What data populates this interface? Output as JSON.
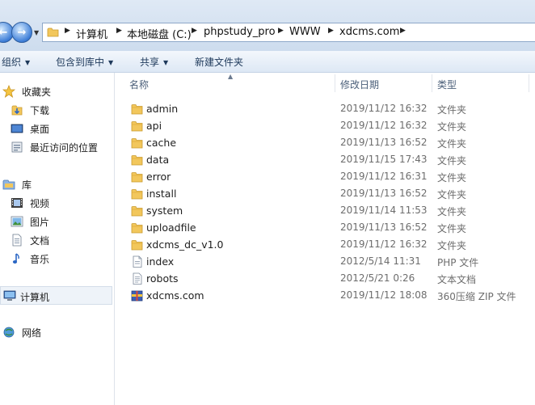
{
  "address": {
    "crumbs": [
      "计算机",
      "本地磁盘 (C:)",
      "phpstudy_pro",
      "WWW",
      "xdcms.com"
    ]
  },
  "toolbar": {
    "organize": "组织",
    "include_in_library": "包含到库中",
    "share": "共享",
    "new_folder": "新建文件夹"
  },
  "navpane": {
    "favorites": "收藏夹",
    "downloads": "下载",
    "desktop": "桌面",
    "recent": "最近访问的位置",
    "libraries": "库",
    "videos": "视频",
    "pictures": "图片",
    "documents": "文档",
    "music": "音乐",
    "computer": "计算机",
    "network": "网络"
  },
  "columns": {
    "name": "名称",
    "date_modified": "修改日期",
    "type": "类型"
  },
  "files": [
    {
      "name": "admin",
      "date": "2019/11/12 16:32",
      "type": "文件夹",
      "icon": "folder-icon"
    },
    {
      "name": "api",
      "date": "2019/11/12 16:32",
      "type": "文件夹",
      "icon": "folder-icon"
    },
    {
      "name": "cache",
      "date": "2019/11/13 16:52",
      "type": "文件夹",
      "icon": "folder-icon"
    },
    {
      "name": "data",
      "date": "2019/11/15 17:43",
      "type": "文件夹",
      "icon": "folder-icon"
    },
    {
      "name": "error",
      "date": "2019/11/12 16:31",
      "type": "文件夹",
      "icon": "folder-icon"
    },
    {
      "name": "install",
      "date": "2019/11/13 16:52",
      "type": "文件夹",
      "icon": "folder-icon"
    },
    {
      "name": "system",
      "date": "2019/11/14 11:53",
      "type": "文件夹",
      "icon": "folder-icon"
    },
    {
      "name": "uploadfile",
      "date": "2019/11/13 16:52",
      "type": "文件夹",
      "icon": "folder-icon"
    },
    {
      "name": "xdcms_dc_v1.0",
      "date": "2019/11/12 16:32",
      "type": "文件夹",
      "icon": "folder-icon"
    },
    {
      "name": "index",
      "date": "2012/5/14 11:31",
      "type": "PHP 文件",
      "icon": "php-file-icon"
    },
    {
      "name": "robots",
      "date": "2012/5/21 0:26",
      "type": "文本文档",
      "icon": "text-file-icon"
    },
    {
      "name": "xdcms.com",
      "date": "2019/11/12 18:08",
      "type": "360压缩 ZIP 文件",
      "icon": "zip-archive-icon"
    }
  ],
  "colors": {
    "accent": "#1e395b",
    "folder": "#f2c75c",
    "selected_nav": "#eef3f9"
  }
}
